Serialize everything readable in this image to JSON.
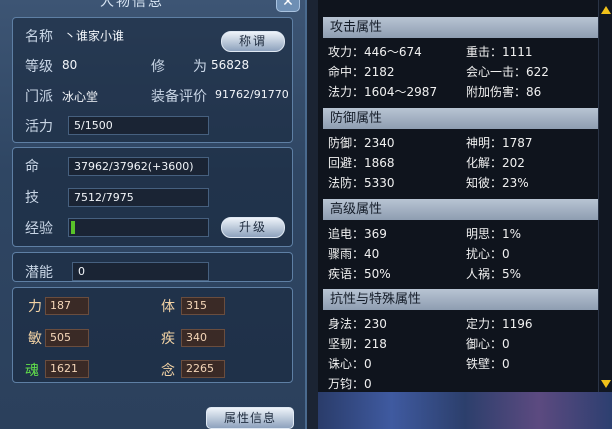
{
  "window": {
    "title": "人物信息",
    "close_label": "✕"
  },
  "basic": {
    "name_label": "名称",
    "name_value": "丶谁家小谁",
    "title_button": "称谓",
    "level_label": "等级",
    "level_value": "80",
    "cultivation_label": "修　　为",
    "cultivation_value": "56828",
    "sect_label": "门派",
    "sect_value": "冰心堂",
    "gear_label": "装备评价",
    "gear_value": "91762/91770",
    "vitality_label": "活力",
    "vitality_value": "5/1500"
  },
  "status": {
    "hp_label": "命",
    "hp_value": "37962/37962(+3600)",
    "skill_label": "技",
    "skill_value": "7512/7975",
    "exp_label": "经验",
    "exp_progress": 0.03,
    "upgrade_button": "升级"
  },
  "potential": {
    "label": "潜能",
    "value": "0"
  },
  "attributes": {
    "str_label": "力",
    "str_value": "187",
    "con_label": "体",
    "con_value": "315",
    "agi_label": "敏",
    "agi_value": "505",
    "spd_label": "疾",
    "spd_value": "340",
    "soul_label": "魂",
    "soul_value": "1621",
    "mind_label": "念",
    "mind_value": "2265"
  },
  "footer": {
    "info_button": "属性信息"
  },
  "right": {
    "attack": {
      "header": "攻击属性",
      "rows": [
        [
          "攻力：446～674",
          "重击：1111"
        ],
        [
          "命中：2182",
          "会心一击：622"
        ],
        [
          "法力：1604～2987",
          "附加伤害：86"
        ]
      ]
    },
    "defense": {
      "header": "防御属性",
      "rows": [
        [
          "防御：2340",
          "神明：1787"
        ],
        [
          "回避：1868",
          "化解：202"
        ],
        [
          "法防：5330",
          "知彼：23%"
        ]
      ]
    },
    "advanced": {
      "header": "高级属性",
      "rows": [
        [
          "追电：369",
          "明思：1%"
        ],
        [
          "骤雨：40",
          "扰心：0"
        ],
        [
          "疾语：50%",
          "人祸：5%"
        ]
      ]
    },
    "special": {
      "header": "抗性与特殊属性",
      "rows": [
        [
          "身法：230",
          "定力：1196"
        ],
        [
          "坚韧：218",
          "御心：0"
        ],
        [
          "诛心：0",
          "铁壁：0"
        ],
        [
          "万钧：0",
          ""
        ]
      ]
    }
  },
  "colors": {
    "accent_green": "#59c32a",
    "soul_green": "#62e04a",
    "attr_bg": "#3a2a26",
    "header_bg": "#a7b5c8"
  },
  "icons": {
    "close": "close-icon",
    "scroll_up": "arrow-up-icon",
    "scroll_down": "arrow-down-icon"
  }
}
